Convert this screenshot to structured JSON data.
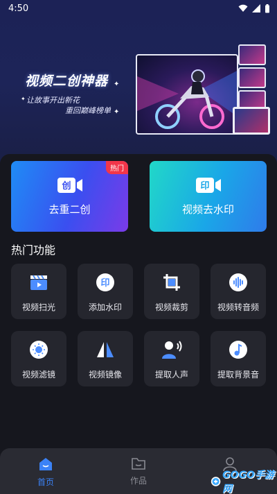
{
  "status": {
    "time": "4:50"
  },
  "banner": {
    "title": "视频二创神器",
    "subtitle1": "让故事开出新花",
    "subtitle2": "重回巅峰榜单"
  },
  "cards": [
    {
      "label": "去重二创",
      "badge": "热门",
      "icon_text": "创",
      "icon": "camera-icon"
    },
    {
      "label": "视频去水印",
      "icon_text": "印",
      "icon": "camera-icon"
    }
  ],
  "section_title": "热门功能",
  "tools": [
    {
      "label": "视频扫光",
      "icon": "clapperboard-icon"
    },
    {
      "label": "添加水印",
      "icon": "watermark-stamp-icon",
      "icon_text": "印"
    },
    {
      "label": "视频裁剪",
      "icon": "crop-icon"
    },
    {
      "label": "视频转音频",
      "icon": "audio-wave-icon"
    },
    {
      "label": "视频滤镜",
      "icon": "filter-icon"
    },
    {
      "label": "视频镜像",
      "icon": "mirror-icon"
    },
    {
      "label": "提取人声",
      "icon": "voice-person-icon"
    },
    {
      "label": "提取背景音",
      "icon": "music-note-icon"
    }
  ],
  "nav": [
    {
      "label": "首页",
      "icon": "home-icon",
      "active": true
    },
    {
      "label": "作品",
      "icon": "folder-icon",
      "active": false
    },
    {
      "label": "",
      "icon": "profile-icon",
      "active": false
    }
  ],
  "watermark_logo": {
    "text": "GOGO手游网"
  },
  "colors": {
    "accent": "#3b82f6",
    "nav_active": "#3b82f6",
    "nav_inactive": "#8a8b93",
    "hot_badge": "#f2364a",
    "tool_bg": "#25262e"
  }
}
